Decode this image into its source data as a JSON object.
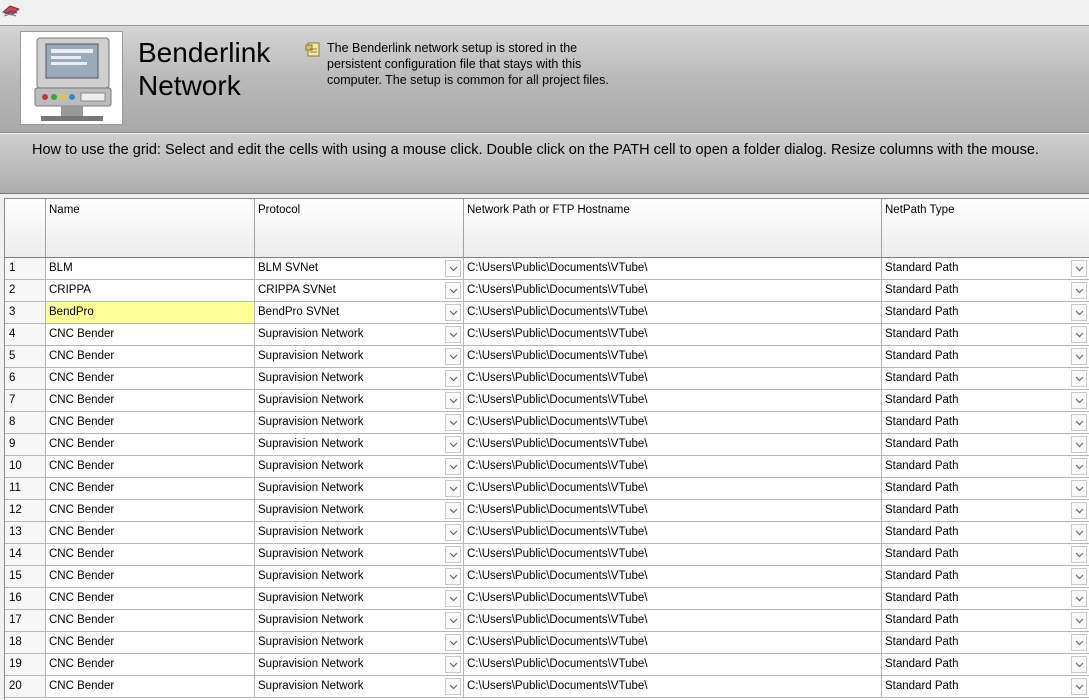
{
  "header": {
    "title_line1": "Benderlink",
    "title_line2": "Network",
    "note": "The Benderlink network setup  is stored in the persistent configuration file that stays with this computer.  The setup is common for all project files.",
    "machine_image_icon": "bender-machine-console-icon",
    "note_icon": "note-icon"
  },
  "instructions": "How to use the grid: Select and edit the cells with using a mouse click.  Double click on the PATH cell to open a folder dialog.  Resize columns with the mouse.",
  "grid": {
    "columns": [
      "Name",
      "Protocol",
      "Network Path or FTP Hostname",
      "NetPath Type"
    ],
    "selected_row": 3,
    "rows": [
      {
        "num": "1",
        "name": "BLM",
        "protocol": "BLM SVNet",
        "path": "C:\\Users\\Public\\Documents\\VTube\\",
        "type": "Standard Path"
      },
      {
        "num": "2",
        "name": "CRIPPA",
        "protocol": "CRIPPA SVNet",
        "path": "C:\\Users\\Public\\Documents\\VTube\\",
        "type": "Standard Path"
      },
      {
        "num": "3",
        "name": "BendPro",
        "protocol": "BendPro SVNet",
        "path": "C:\\Users\\Public\\Documents\\VTube\\",
        "type": "Standard Path"
      },
      {
        "num": "4",
        "name": "CNC Bender",
        "protocol": "Supravision Network",
        "path": "C:\\Users\\Public\\Documents\\VTube\\",
        "type": "Standard Path"
      },
      {
        "num": "5",
        "name": "CNC Bender",
        "protocol": "Supravision Network",
        "path": "C:\\Users\\Public\\Documents\\VTube\\",
        "type": "Standard Path"
      },
      {
        "num": "6",
        "name": "CNC Bender",
        "protocol": "Supravision Network",
        "path": "C:\\Users\\Public\\Documents\\VTube\\",
        "type": "Standard Path"
      },
      {
        "num": "7",
        "name": "CNC Bender",
        "protocol": "Supravision Network",
        "path": "C:\\Users\\Public\\Documents\\VTube\\",
        "type": "Standard Path"
      },
      {
        "num": "8",
        "name": "CNC Bender",
        "protocol": "Supravision Network",
        "path": "C:\\Users\\Public\\Documents\\VTube\\",
        "type": "Standard Path"
      },
      {
        "num": "9",
        "name": "CNC Bender",
        "protocol": "Supravision Network",
        "path": "C:\\Users\\Public\\Documents\\VTube\\",
        "type": "Standard Path"
      },
      {
        "num": "10",
        "name": "CNC Bender",
        "protocol": "Supravision Network",
        "path": "C:\\Users\\Public\\Documents\\VTube\\",
        "type": "Standard Path"
      },
      {
        "num": "11",
        "name": "CNC Bender",
        "protocol": "Supravision Network",
        "path": "C:\\Users\\Public\\Documents\\VTube\\",
        "type": "Standard Path"
      },
      {
        "num": "12",
        "name": "CNC Bender",
        "protocol": "Supravision Network",
        "path": "C:\\Users\\Public\\Documents\\VTube\\",
        "type": "Standard Path"
      },
      {
        "num": "13",
        "name": "CNC Bender",
        "protocol": "Supravision Network",
        "path": "C:\\Users\\Public\\Documents\\VTube\\",
        "type": "Standard Path"
      },
      {
        "num": "14",
        "name": "CNC Bender",
        "protocol": "Supravision Network",
        "path": "C:\\Users\\Public\\Documents\\VTube\\",
        "type": "Standard Path"
      },
      {
        "num": "15",
        "name": "CNC Bender",
        "protocol": "Supravision Network",
        "path": "C:\\Users\\Public\\Documents\\VTube\\",
        "type": "Standard Path"
      },
      {
        "num": "16",
        "name": "CNC Bender",
        "protocol": "Supravision Network",
        "path": "C:\\Users\\Public\\Documents\\VTube\\",
        "type": "Standard Path"
      },
      {
        "num": "17",
        "name": "CNC Bender",
        "protocol": "Supravision Network",
        "path": "C:\\Users\\Public\\Documents\\VTube\\",
        "type": "Standard Path"
      },
      {
        "num": "18",
        "name": "CNC Bender",
        "protocol": "Supravision Network",
        "path": "C:\\Users\\Public\\Documents\\VTube\\",
        "type": "Standard Path"
      },
      {
        "num": "19",
        "name": "CNC Bender",
        "protocol": "Supravision Network",
        "path": "C:\\Users\\Public\\Documents\\VTube\\",
        "type": "Standard Path"
      },
      {
        "num": "20",
        "name": "CNC Bender",
        "protocol": "Supravision Network",
        "path": "C:\\Users\\Public\\Documents\\VTube\\",
        "type": "Standard Path"
      }
    ]
  },
  "colors": {
    "selected_cell": "#ffff99",
    "header_gray": "#b7b7b7"
  }
}
